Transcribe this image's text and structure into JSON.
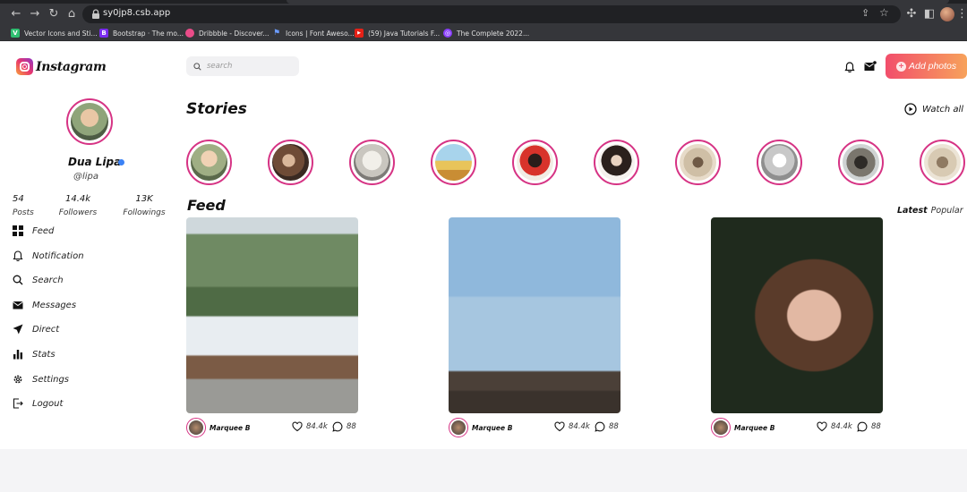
{
  "browser": {
    "url": "sy0jp8.csb.app",
    "bookmarks": [
      {
        "label": "Vector Icons and Sti...",
        "color": "#2fbf71",
        "glyph": "V"
      },
      {
        "label": "Bootstrap · The mo...",
        "color": "#7a2bf0",
        "glyph": "B"
      },
      {
        "label": "Dribbble - Discover...",
        "color": "#ea4c89",
        "glyph": ""
      },
      {
        "label": "Icons | Font Aweso...",
        "color": "#3b6fd8",
        "glyph": ""
      },
      {
        "label": "(59) Java Tutorials F...",
        "color": "#e62117",
        "glyph": "▶"
      },
      {
        "label": "The Complete 2022...",
        "color": "#8a3ffc",
        "glyph": "◎"
      }
    ]
  },
  "app": {
    "logo_text": "Instagram",
    "search": {
      "placeholder": "search"
    },
    "add_button_label": "Add photos",
    "accent": "#d63384"
  },
  "profile": {
    "name": "Dua Lipa",
    "handle": "@lipa",
    "stats": [
      {
        "value": "54",
        "label": "Posts"
      },
      {
        "value": "14.4k",
        "label": "Followers"
      },
      {
        "value": "13K",
        "label": "Followings"
      }
    ]
  },
  "nav": [
    {
      "label": "Feed",
      "icon": "grid-icon"
    },
    {
      "label": "Notification",
      "icon": "bell-icon"
    },
    {
      "label": "Search",
      "icon": "search-icon"
    },
    {
      "label": "Messages",
      "icon": "mail-icon"
    },
    {
      "label": "Direct",
      "icon": "send-icon"
    },
    {
      "label": "Stats",
      "icon": "bar-chart-icon"
    },
    {
      "label": "Settings",
      "icon": "gear-icon"
    },
    {
      "label": "Logout",
      "icon": "logout-icon"
    }
  ],
  "stories": {
    "title": "Stories",
    "watch_all": "Watch all"
  },
  "feed": {
    "title": "Feed",
    "sort_latest": "Latest",
    "sort_popular": "Popular",
    "posts": [
      {
        "author": "Marquee B",
        "likes": "84.4k",
        "comments": "88"
      },
      {
        "author": "Marquee B",
        "likes": "84.4k",
        "comments": "88"
      },
      {
        "author": "Marquee B",
        "likes": "84.4k",
        "comments": "88"
      }
    ]
  }
}
